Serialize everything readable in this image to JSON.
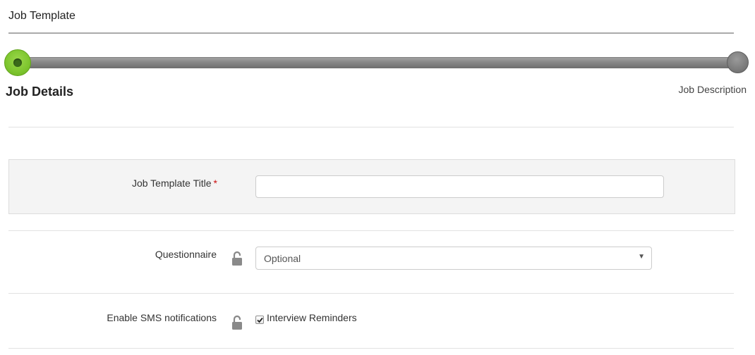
{
  "header": {
    "title": "Job Template"
  },
  "stepper": {
    "current_step": "Job Details",
    "next_step": "Job Description",
    "active_color": "#7dc52e",
    "inactive_color": "#7c7c7c"
  },
  "form": {
    "title_field": {
      "label": "Job Template Title",
      "required_marker": "*",
      "value": "",
      "placeholder": ""
    },
    "questionnaire": {
      "label": "Questionnaire",
      "selected": "Optional",
      "lock_icon": "unlocked-padlock-icon"
    },
    "sms": {
      "label": "Enable SMS notifications",
      "lock_icon": "unlocked-padlock-icon",
      "checkbox_label": "Interview Reminders",
      "checked": true
    }
  },
  "colors": {
    "required": "#cc1111",
    "panel_background": "#f4f4f4"
  }
}
